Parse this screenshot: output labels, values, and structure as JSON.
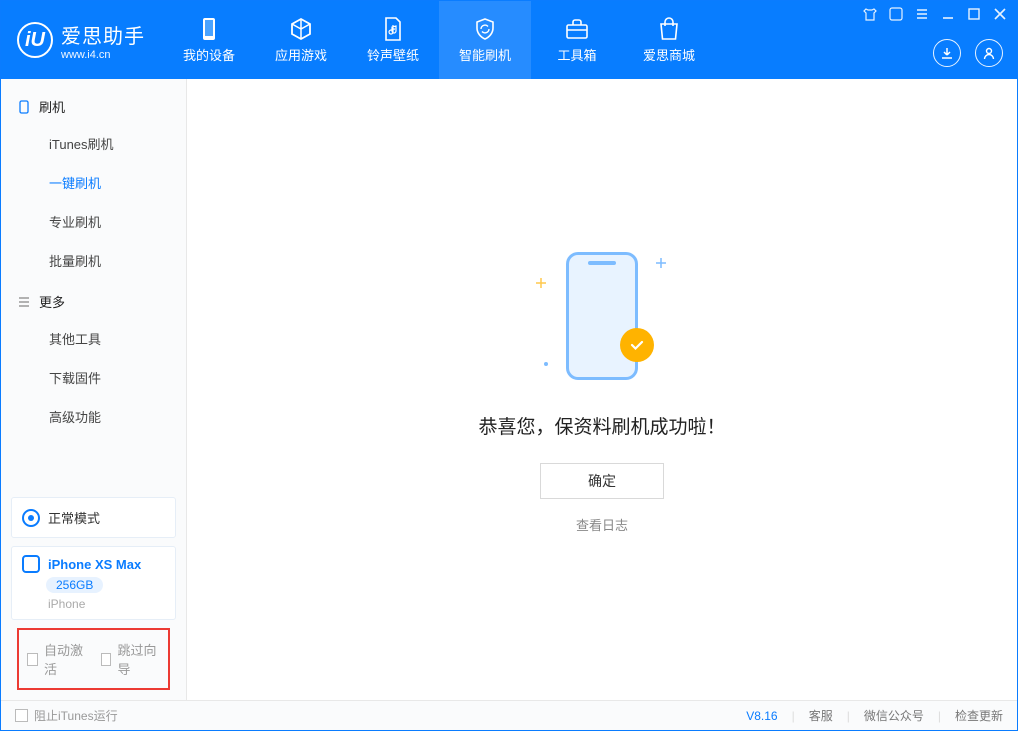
{
  "app": {
    "name_cn": "爱思助手",
    "name_en": "www.i4.cn",
    "logo_letter": "iU"
  },
  "tabs": [
    {
      "label": "我的设备"
    },
    {
      "label": "应用游戏"
    },
    {
      "label": "铃声壁纸"
    },
    {
      "label": "智能刷机",
      "active": true
    },
    {
      "label": "工具箱"
    },
    {
      "label": "爱思商城"
    }
  ],
  "sidebar": {
    "sections": [
      {
        "title": "刷机",
        "icon": "phone",
        "items": [
          {
            "label": "iTunes刷机"
          },
          {
            "label": "一键刷机",
            "active": true
          },
          {
            "label": "专业刷机"
          },
          {
            "label": "批量刷机"
          }
        ]
      },
      {
        "title": "更多",
        "icon": "menu",
        "items": [
          {
            "label": "其他工具"
          },
          {
            "label": "下载固件"
          },
          {
            "label": "高级功能"
          }
        ]
      }
    ],
    "mode": "正常模式",
    "device": {
      "name": "iPhone XS Max",
      "storage": "256GB",
      "sub": "iPhone"
    },
    "checkboxes": {
      "auto_activate": "自动激活",
      "skip_guide": "跳过向导"
    }
  },
  "main": {
    "success_text": "恭喜您，保资料刷机成功啦！",
    "ok_button": "确定",
    "view_log": "查看日志"
  },
  "footer": {
    "prevent_itunes": "阻止iTunes运行",
    "version": "V8.16",
    "links": [
      "客服",
      "微信公众号",
      "检查更新"
    ]
  },
  "colors": {
    "primary": "#087dff",
    "accent": "#ffb300",
    "highlight_border": "#ec3a33"
  }
}
